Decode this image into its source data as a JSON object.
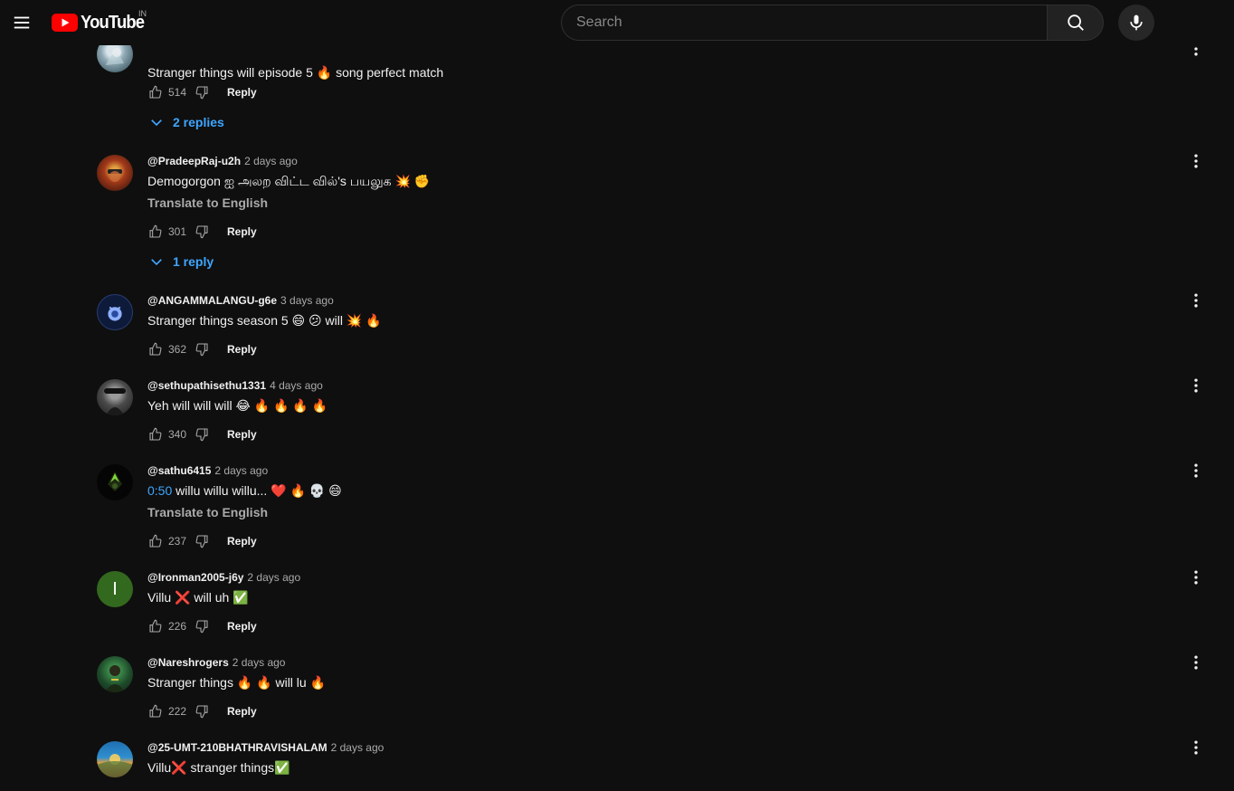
{
  "header": {
    "logo_text": "YouTube",
    "region": "IN",
    "search_placeholder": "Search"
  },
  "comments": [
    {
      "author": "",
      "time": "",
      "text": "Stranger things will episode 5 🔥 song perfect match",
      "likes": "514",
      "reply_label": "Reply",
      "replies": "2 replies"
    },
    {
      "author": "@PradeepRaj-u2h",
      "time": "2 days ago",
      "text": "Demogorgon ஐ அலற விட்ட வில்'s பயலுக 💥 ✊",
      "translate": "Translate to English",
      "likes": "301",
      "reply_label": "Reply",
      "replies": "1 reply"
    },
    {
      "author": "@ANGAMMALANGU-g6e",
      "time": "3 days ago",
      "text": "Stranger things season 5 😄 😕 will 💥 🔥",
      "likes": "362",
      "reply_label": "Reply"
    },
    {
      "author": "@sethupathisethu1331",
      "time": "4 days ago",
      "text": "Yeh will will will 😂 🔥 🔥 🔥 🔥",
      "likes": "340",
      "reply_label": "Reply"
    },
    {
      "author": "@sathu6415",
      "time": "2 days ago",
      "timestamp": "0:50",
      "text": " willu willu willu... ❤️ 🔥 💀 😄",
      "translate": "Translate to English",
      "likes": "237",
      "reply_label": "Reply"
    },
    {
      "author": "@Ironman2005-j6y",
      "time": "2 days ago",
      "avatar_letter": "I",
      "text": "Villu ❌ will uh ✅",
      "likes": "226",
      "reply_label": "Reply"
    },
    {
      "author": "@Nareshrogers",
      "time": "2 days ago",
      "text": "Stranger things 🔥 🔥 will lu 🔥",
      "likes": "222",
      "reply_label": "Reply"
    },
    {
      "author": "@25-UMT-210BHATHRAVISHALAM",
      "time": "2 days ago",
      "text": "Villu❌ stranger things✅"
    }
  ],
  "colors": {
    "background": "#0f0f0f",
    "link_blue": "#3ea6ff",
    "brand_red": "#ff0000",
    "muted": "#aaaaaa"
  }
}
